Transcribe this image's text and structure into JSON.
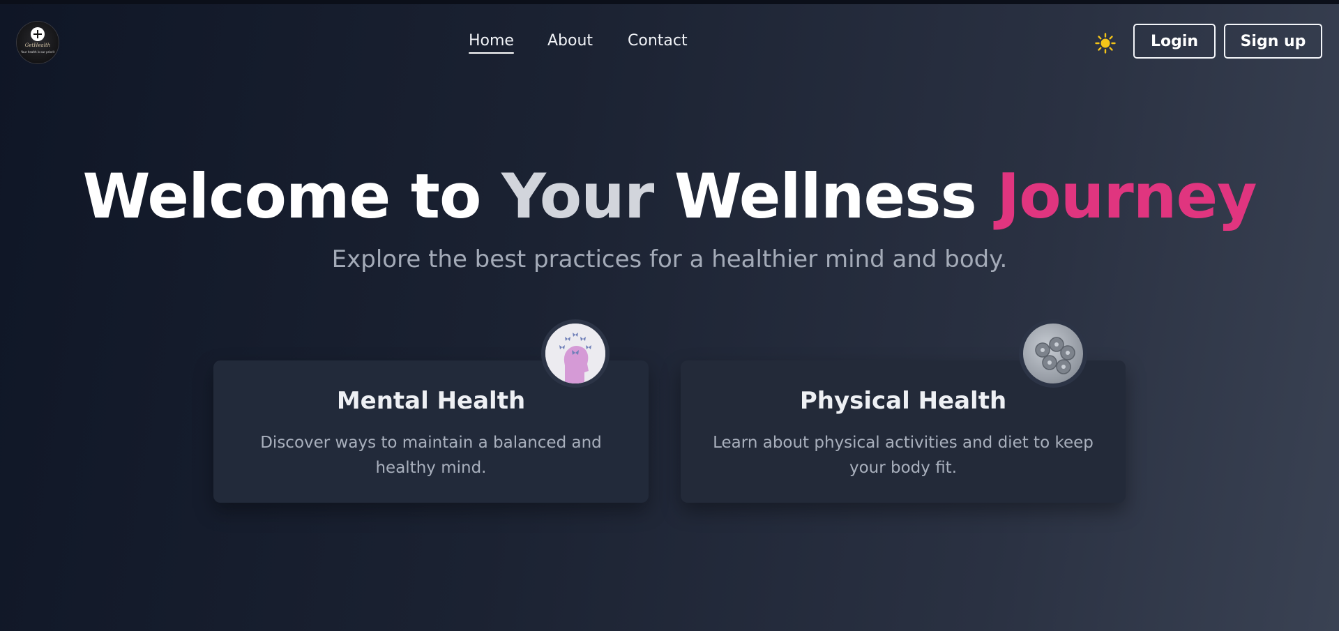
{
  "brand": {
    "logo_icon": "medical-plus-icon",
    "logo_script": "GetHealth",
    "logo_tagline": "Your health is our priority"
  },
  "nav": {
    "links": [
      {
        "label": "Home",
        "active": true
      },
      {
        "label": "About",
        "active": false
      },
      {
        "label": "Contact",
        "active": false
      }
    ],
    "theme_toggle_icon": "sun-icon",
    "login_label": "Login",
    "signup_label": "Sign up"
  },
  "hero": {
    "title_words": [
      "Welcome to",
      "Your",
      "Wellness",
      "Journey"
    ],
    "subtitle": "Explore the best practices for a healthier mind and body."
  },
  "cards": [
    {
      "title": "Mental Health",
      "description": "Discover ways to maintain a balanced and healthy mind.",
      "image_icon": "head-with-butterflies-icon"
    },
    {
      "title": "Physical Health",
      "description": "Learn about physical activities and diet to keep your body fit.",
      "image_icon": "weight-plates-icon"
    }
  ],
  "colors": {
    "accent": "#e0357f",
    "sun": "#f5c518",
    "card_bg": "#222a3a",
    "text_muted": "#a4abb8"
  }
}
